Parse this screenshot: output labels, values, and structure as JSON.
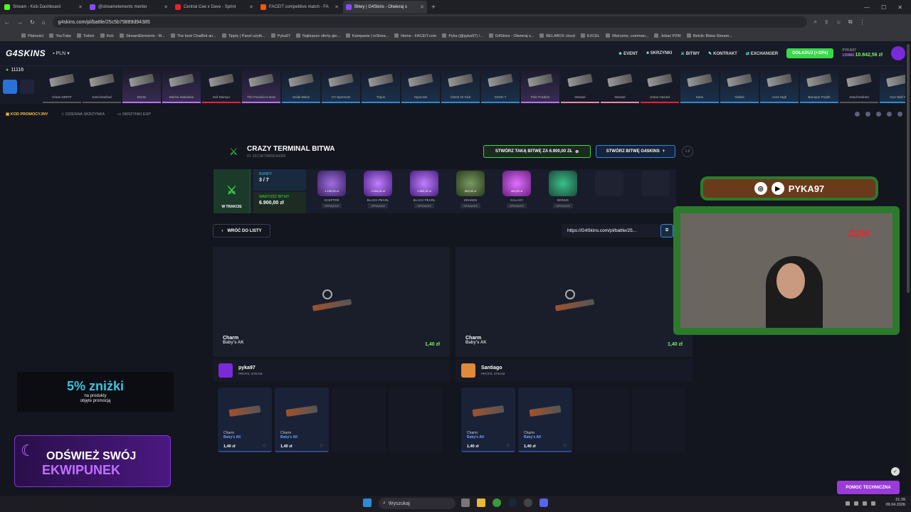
{
  "browser": {
    "tabs": [
      {
        "label": "Stream - Kick Dashboard",
        "color": "#53fc18",
        "active": false
      },
      {
        "label": "@streamelements mentio",
        "color": "#8a4af3",
        "active": false
      },
      {
        "label": "Central Cee x Dave - Sprint",
        "color": "#e22",
        "active": false
      },
      {
        "label": "FACEIT competitive match - FA",
        "color": "#f50",
        "active": false
      },
      {
        "label": "Bitwy | G4Skins - Otwieraj s",
        "color": "#8a4af3",
        "active": true
      }
    ],
    "url": "g4skins.com/pl/battle/25c5b79889d94385",
    "bookmarks": [
      "Płatności",
      "YouTube",
      "Twitch",
      "Kick",
      "StreamElements - M...",
      "The best ChatBot an...",
      "Tipply | Panel użytk...",
      "Pyka97",
      "Najlepsze oferty gie...",
      "Kampanie | inStrea...",
      "Home - FACEIT.com",
      "Pyka (@pyka97) /...",
      "G4Skins - Otwieraj s...",
      "BELABOX cloud",
      "EXCEL",
      "Welcome, comman...",
      "Jebać PZW",
      "Betclic Bitwa Stream..."
    ]
  },
  "site": {
    "logo": "G4SKINS",
    "currency": "PLN",
    "nav": [
      {
        "icon": "star-icon",
        "label": "EVENT"
      },
      {
        "icon": "box-icon",
        "label": "SKRZYNKI"
      },
      {
        "icon": "swords-icon",
        "label": "BITWY"
      },
      {
        "icon": "contract-icon",
        "label": "KONTRAKT"
      },
      {
        "icon": "exchange-icon",
        "label": "EXCHANGER"
      }
    ],
    "deposit_label": "DOŁADUJ (+10%)",
    "balance_label": "PYKA97",
    "balance_points": "135960",
    "balance_amount": "10.842,56 zł",
    "online_count": "11116",
    "drops": [
      "Urban DDPAT",
      "Sand Dashed",
      "Mortis",
      "Mecha Industries",
      "Evil Daimyo",
      "The Fuschia Is Now",
      "Oxide Blaze",
      "CV Spectrum",
      "Tripus",
      "Hypnosis",
      "Clutch Or Kick",
      "SSSG-7",
      "Pole Position",
      "Weasel",
      "Weasel",
      "Urban Hazard",
      "Kami",
      "Gelled",
      "Aces High",
      "Baroque Purple",
      "Sand Dashed",
      "Gun Wall Ca"
    ],
    "subnav": [
      "KOD PROMOCYJNY",
      "DZIENNA SKRZYNKA",
      "SKRZYNKI EXP"
    ]
  },
  "battle": {
    "title": "CRAZY TERMINAL BITWA",
    "id": "ID: 25C5B79889D94385",
    "create_same": "STWÓRZ TAKĄ BITWĘ ZA 6.900,00 ZŁ",
    "create_g4": "STWÓRZ BITWĘ G4SKINS",
    "version": "1.0",
    "status": "W TRAKCIE",
    "rounds_label": "RUNDY",
    "rounds_value": "3 / 7",
    "value_label": "WARTOŚĆ BITWY",
    "value_amount": "6.900,00 zł",
    "cases": [
      {
        "name": "SCEPTRE",
        "price": "1.150,00 zł",
        "tag": "SPRAWDŹ"
      },
      {
        "name": "BLACK PEARL",
        "price": "1.500,00 zł",
        "tag": "SPRAWDŹ"
      },
      {
        "name": "BLACK PEARL",
        "price": "1.500,00 zł",
        "tag": "SPRAWDŹ"
      },
      {
        "name": "KRAKEN",
        "price": "600,00 zł",
        "tag": "SPRAWDŹ"
      },
      {
        "name": "GALAXY",
        "price": "400,00 zł",
        "tag": "SPRAWDŹ"
      },
      {
        "name": "BONUS",
        "price": "",
        "tag": "SPRAWDŹ"
      }
    ],
    "back_label": "WRÓĆ DO LISTY",
    "share_link": "https://G4Skins.com/pl/battle/25..."
  },
  "players": [
    {
      "name": "pyka97",
      "profile": "PROFIL STEAM",
      "item_type": "Charm",
      "item_name": "Baby's AK",
      "price": "1,40 zł",
      "avatar_color": "#7a2ad8",
      "cards": [
        {
          "type": "Charm",
          "name": "Baby's AK",
          "price": "1,40 zł"
        },
        {
          "type": "Charm",
          "name": "Baby's AK",
          "price": "1,40 zł"
        }
      ]
    },
    {
      "name": "Santiago",
      "profile": "PROFIL STEAM",
      "item_type": "Charm",
      "item_name": "Baby's AK",
      "price": "1,40 zł",
      "avatar_color": "#e08a3a",
      "cards": [
        {
          "type": "Charm",
          "name": "Baby's AK",
          "price": "1,40 zł"
        },
        {
          "type": "Charm",
          "name": "Baby's AK",
          "price": "1,40 zł"
        }
      ]
    }
  ],
  "overlay": {
    "promo_big": "5% zniżki",
    "promo_small1": "na produkty",
    "promo_small2": "objęte promocją",
    "refresh_l1": "ODŚWIEŻ SWÓJ",
    "refresh_l2": "EKWIPUNEK",
    "banner_name": "PYKA97",
    "cam_logo": "DZIK"
  },
  "help_label": "POMOC TECHNICZNA",
  "taskbar": {
    "search_placeholder": "Wyszukaj",
    "time": "21:39",
    "date": "09.04.2026"
  }
}
